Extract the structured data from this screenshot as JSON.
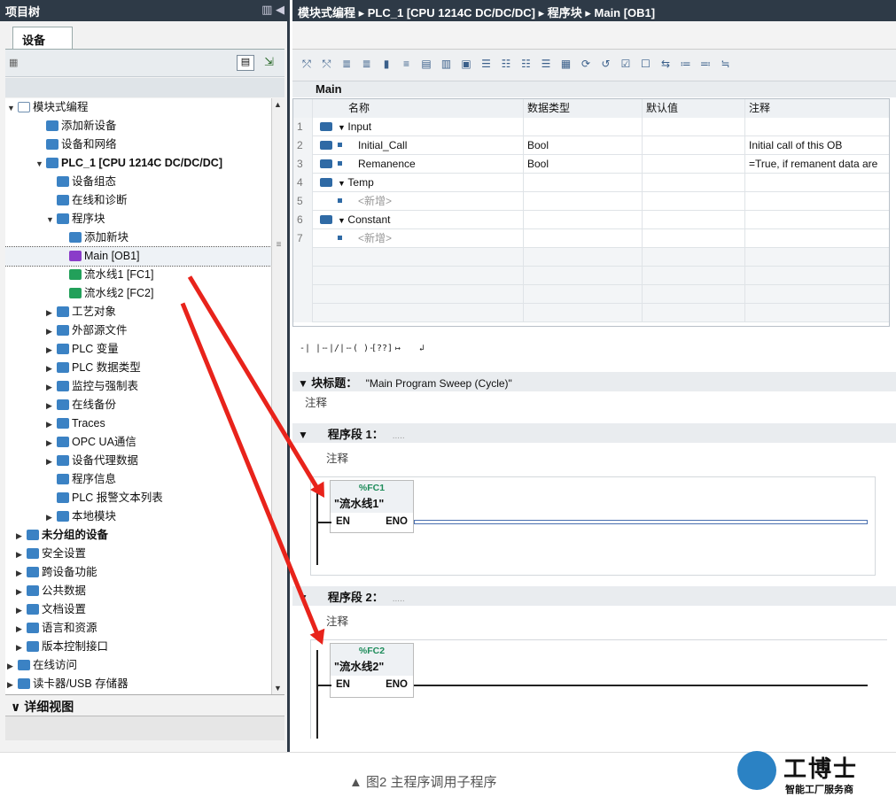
{
  "project_tree": {
    "title": "项目树",
    "tab": "设备",
    "items": [
      {
        "label": "模块式编程",
        "level": 0,
        "arrow": "▼",
        "bold": false
      },
      {
        "label": "添加新设备",
        "level": 2,
        "arrow": "",
        "bold": false
      },
      {
        "label": "设备和网络",
        "level": 2,
        "arrow": "",
        "bold": false
      },
      {
        "label": "PLC_1 [CPU 1214C DC/DC/DC]",
        "level": 2,
        "arrow": "▼",
        "bold": true
      },
      {
        "label": "设备组态",
        "level": 3,
        "arrow": "",
        "bold": false
      },
      {
        "label": "在线和诊断",
        "level": 3,
        "arrow": "",
        "bold": false
      },
      {
        "label": "程序块",
        "level": 3,
        "arrow": "▼",
        "bold": false
      },
      {
        "label": "添加新块",
        "level": 4,
        "arrow": "",
        "bold": false
      },
      {
        "label": "Main [OB1]",
        "level": 4,
        "arrow": "",
        "bold": false,
        "selected": true
      },
      {
        "label": "流水线1 [FC1]",
        "level": 4,
        "arrow": "",
        "bold": false
      },
      {
        "label": "流水线2 [FC2]",
        "level": 4,
        "arrow": "",
        "bold": false
      },
      {
        "label": "工艺对象",
        "level": 3,
        "arrow": "▶",
        "bold": false
      },
      {
        "label": "外部源文件",
        "level": 3,
        "arrow": "▶",
        "bold": false
      },
      {
        "label": "PLC 变量",
        "level": 3,
        "arrow": "▶",
        "bold": false
      },
      {
        "label": "PLC 数据类型",
        "level": 3,
        "arrow": "▶",
        "bold": false
      },
      {
        "label": "监控与强制表",
        "level": 3,
        "arrow": "▶",
        "bold": false
      },
      {
        "label": "在线备份",
        "level": 3,
        "arrow": "▶",
        "bold": false
      },
      {
        "label": "Traces",
        "level": 3,
        "arrow": "▶",
        "bold": false
      },
      {
        "label": "OPC UA通信",
        "level": 3,
        "arrow": "▶",
        "bold": false
      },
      {
        "label": "设备代理数据",
        "level": 3,
        "arrow": "▶",
        "bold": false
      },
      {
        "label": "程序信息",
        "level": 3,
        "arrow": "",
        "bold": false
      },
      {
        "label": "PLC 报警文本列表",
        "level": 3,
        "arrow": "",
        "bold": false
      },
      {
        "label": "本地模块",
        "level": 3,
        "arrow": "▶",
        "bold": false
      },
      {
        "label": "未分组的设备",
        "level": 1,
        "arrow": "▶",
        "bold": true
      },
      {
        "label": "安全设置",
        "level": 1,
        "arrow": "▶",
        "bold": false
      },
      {
        "label": "跨设备功能",
        "level": 1,
        "arrow": "▶",
        "bold": false
      },
      {
        "label": "公共数据",
        "level": 1,
        "arrow": "▶",
        "bold": false
      },
      {
        "label": "文档设置",
        "level": 1,
        "arrow": "▶",
        "bold": false
      },
      {
        "label": "语言和资源",
        "level": 1,
        "arrow": "▶",
        "bold": false
      },
      {
        "label": "版本控制接口",
        "level": 1,
        "arrow": "▶",
        "bold": false
      },
      {
        "label": "在线访问",
        "level": 0,
        "arrow": "▶",
        "bold": false
      },
      {
        "label": "读卡器/USB 存储器",
        "level": 0,
        "arrow": "▶",
        "bold": false
      }
    ],
    "detail_view": "详细视图"
  },
  "editor": {
    "breadcrumb": "模块式编程 ▸ PLC_1 [CPU 1214C DC/DC/DC] ▸ 程序块 ▸ Main [OB1]",
    "block_name": "Main",
    "table": {
      "headers": [
        "名称",
        "数据类型",
        "默认值",
        "注释"
      ],
      "rows": [
        {
          "num": "1",
          "kind": "section",
          "name": "Input",
          "type": "",
          "default": "",
          "comment": ""
        },
        {
          "num": "2",
          "kind": "var",
          "name": "Initial_Call",
          "type": "Bool",
          "default": "",
          "comment": "Initial call of this OB"
        },
        {
          "num": "3",
          "kind": "var",
          "name": "Remanence",
          "type": "Bool",
          "default": "",
          "comment": "=True, if remanent data are"
        },
        {
          "num": "4",
          "kind": "section",
          "name": "Temp",
          "type": "",
          "default": "",
          "comment": ""
        },
        {
          "num": "5",
          "kind": "new",
          "name": "<新增>",
          "type": "",
          "default": "",
          "comment": ""
        },
        {
          "num": "6",
          "kind": "section",
          "name": "Constant",
          "type": "",
          "default": "",
          "comment": ""
        },
        {
          "num": "7",
          "kind": "new",
          "name": "<新增>",
          "type": "",
          "default": "",
          "comment": ""
        }
      ]
    },
    "ladder_tools": [
      "-| |-",
      "-|/|-",
      "-( )-",
      "[??]",
      "↦",
      "↲"
    ],
    "block_title_label": "块标题：",
    "block_title_value": "\"Main Program Sweep (Cycle)\"",
    "block_comment": "注释",
    "networks": [
      {
        "title": "程序段 1：",
        "dots": ".....",
        "comment": "注释",
        "fc_addr": "%FC1",
        "fc_name": "\"流水线1\"",
        "en": "EN",
        "eno": "ENO"
      },
      {
        "title": "程序段 2：",
        "dots": ".....",
        "comment": "注释",
        "fc_addr": "%FC2",
        "fc_name": "\"流水线2\"",
        "en": "EN",
        "eno": "ENO"
      }
    ]
  },
  "caption": "▲ 图2 主程序调用子程序",
  "logo": {
    "title": "工博士",
    "subtitle": "智能工厂服务商"
  },
  "colors": {
    "title_bar": "#2e3a47",
    "arrow": "#e8231b",
    "fc_green": "#1e8c5a",
    "io_blue": "#2f6aa5"
  }
}
